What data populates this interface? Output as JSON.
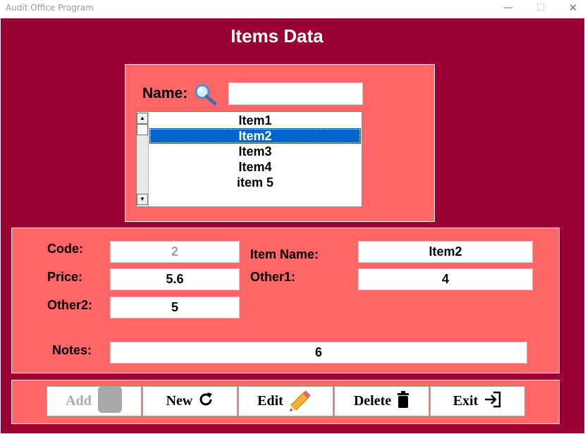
{
  "window": {
    "title": "Audit Office Program",
    "controls": {
      "minimize": "—",
      "maximize": "☐",
      "close": "✕"
    }
  },
  "heading": "Items Data",
  "search": {
    "label": "Name:",
    "icon": "magnifier-icon",
    "value": ""
  },
  "list": {
    "items": [
      "Item1",
      "Item2",
      "Item3",
      "Item4",
      "item 5"
    ],
    "selected_index": 1
  },
  "details": {
    "code_label": "Code:",
    "code_value": "2",
    "item_name_label": "Item Name:",
    "item_name_value": "Item2",
    "price_label": "Price:",
    "price_value": "5.6",
    "other1_label": "Other1:",
    "other1_value": "4",
    "other2_label": "Other2:",
    "other2_value": "5",
    "notes_label": "Notes:",
    "notes_value": "6"
  },
  "buttons": {
    "add": "Add",
    "new": "New",
    "edit": "Edit",
    "delete": "Delete",
    "exit": "Exit"
  },
  "colors": {
    "form_bg": "#990033",
    "panel_bg": "#ff6666",
    "selection": "#0066cc"
  }
}
